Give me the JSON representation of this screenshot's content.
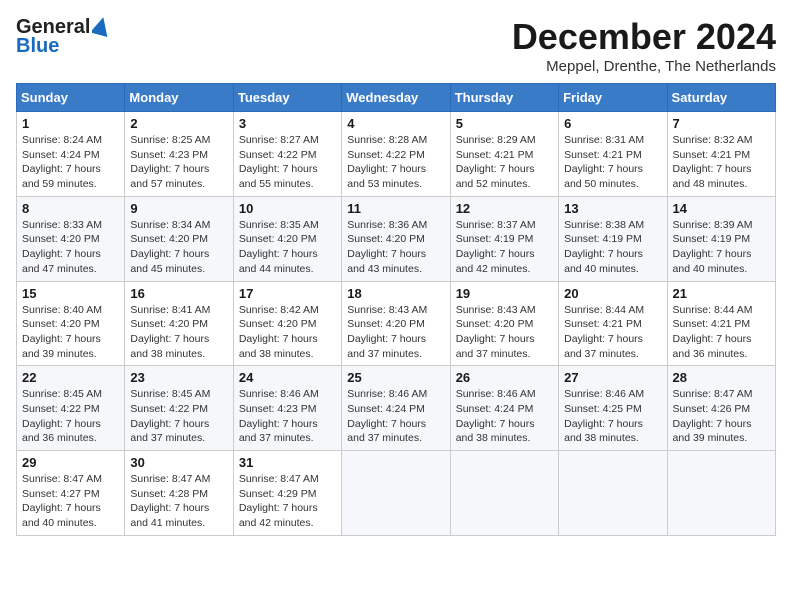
{
  "header": {
    "logo_general": "General",
    "logo_blue": "Blue",
    "month_title": "December 2024",
    "location": "Meppel, Drenthe, The Netherlands"
  },
  "days_of_week": [
    "Sunday",
    "Monday",
    "Tuesday",
    "Wednesday",
    "Thursday",
    "Friday",
    "Saturday"
  ],
  "weeks": [
    [
      {
        "day": "1",
        "sunrise": "Sunrise: 8:24 AM",
        "sunset": "Sunset: 4:24 PM",
        "daylight": "Daylight: 7 hours and 59 minutes."
      },
      {
        "day": "2",
        "sunrise": "Sunrise: 8:25 AM",
        "sunset": "Sunset: 4:23 PM",
        "daylight": "Daylight: 7 hours and 57 minutes."
      },
      {
        "day": "3",
        "sunrise": "Sunrise: 8:27 AM",
        "sunset": "Sunset: 4:22 PM",
        "daylight": "Daylight: 7 hours and 55 minutes."
      },
      {
        "day": "4",
        "sunrise": "Sunrise: 8:28 AM",
        "sunset": "Sunset: 4:22 PM",
        "daylight": "Daylight: 7 hours and 53 minutes."
      },
      {
        "day": "5",
        "sunrise": "Sunrise: 8:29 AM",
        "sunset": "Sunset: 4:21 PM",
        "daylight": "Daylight: 7 hours and 52 minutes."
      },
      {
        "day": "6",
        "sunrise": "Sunrise: 8:31 AM",
        "sunset": "Sunset: 4:21 PM",
        "daylight": "Daylight: 7 hours and 50 minutes."
      },
      {
        "day": "7",
        "sunrise": "Sunrise: 8:32 AM",
        "sunset": "Sunset: 4:21 PM",
        "daylight": "Daylight: 7 hours and 48 minutes."
      }
    ],
    [
      {
        "day": "8",
        "sunrise": "Sunrise: 8:33 AM",
        "sunset": "Sunset: 4:20 PM",
        "daylight": "Daylight: 7 hours and 47 minutes."
      },
      {
        "day": "9",
        "sunrise": "Sunrise: 8:34 AM",
        "sunset": "Sunset: 4:20 PM",
        "daylight": "Daylight: 7 hours and 45 minutes."
      },
      {
        "day": "10",
        "sunrise": "Sunrise: 8:35 AM",
        "sunset": "Sunset: 4:20 PM",
        "daylight": "Daylight: 7 hours and 44 minutes."
      },
      {
        "day": "11",
        "sunrise": "Sunrise: 8:36 AM",
        "sunset": "Sunset: 4:20 PM",
        "daylight": "Daylight: 7 hours and 43 minutes."
      },
      {
        "day": "12",
        "sunrise": "Sunrise: 8:37 AM",
        "sunset": "Sunset: 4:19 PM",
        "daylight": "Daylight: 7 hours and 42 minutes."
      },
      {
        "day": "13",
        "sunrise": "Sunrise: 8:38 AM",
        "sunset": "Sunset: 4:19 PM",
        "daylight": "Daylight: 7 hours and 40 minutes."
      },
      {
        "day": "14",
        "sunrise": "Sunrise: 8:39 AM",
        "sunset": "Sunset: 4:19 PM",
        "daylight": "Daylight: 7 hours and 40 minutes."
      }
    ],
    [
      {
        "day": "15",
        "sunrise": "Sunrise: 8:40 AM",
        "sunset": "Sunset: 4:20 PM",
        "daylight": "Daylight: 7 hours and 39 minutes."
      },
      {
        "day": "16",
        "sunrise": "Sunrise: 8:41 AM",
        "sunset": "Sunset: 4:20 PM",
        "daylight": "Daylight: 7 hours and 38 minutes."
      },
      {
        "day": "17",
        "sunrise": "Sunrise: 8:42 AM",
        "sunset": "Sunset: 4:20 PM",
        "daylight": "Daylight: 7 hours and 38 minutes."
      },
      {
        "day": "18",
        "sunrise": "Sunrise: 8:43 AM",
        "sunset": "Sunset: 4:20 PM",
        "daylight": "Daylight: 7 hours and 37 minutes."
      },
      {
        "day": "19",
        "sunrise": "Sunrise: 8:43 AM",
        "sunset": "Sunset: 4:20 PM",
        "daylight": "Daylight: 7 hours and 37 minutes."
      },
      {
        "day": "20",
        "sunrise": "Sunrise: 8:44 AM",
        "sunset": "Sunset: 4:21 PM",
        "daylight": "Daylight: 7 hours and 37 minutes."
      },
      {
        "day": "21",
        "sunrise": "Sunrise: 8:44 AM",
        "sunset": "Sunset: 4:21 PM",
        "daylight": "Daylight: 7 hours and 36 minutes."
      }
    ],
    [
      {
        "day": "22",
        "sunrise": "Sunrise: 8:45 AM",
        "sunset": "Sunset: 4:22 PM",
        "daylight": "Daylight: 7 hours and 36 minutes."
      },
      {
        "day": "23",
        "sunrise": "Sunrise: 8:45 AM",
        "sunset": "Sunset: 4:22 PM",
        "daylight": "Daylight: 7 hours and 37 minutes."
      },
      {
        "day": "24",
        "sunrise": "Sunrise: 8:46 AM",
        "sunset": "Sunset: 4:23 PM",
        "daylight": "Daylight: 7 hours and 37 minutes."
      },
      {
        "day": "25",
        "sunrise": "Sunrise: 8:46 AM",
        "sunset": "Sunset: 4:24 PM",
        "daylight": "Daylight: 7 hours and 37 minutes."
      },
      {
        "day": "26",
        "sunrise": "Sunrise: 8:46 AM",
        "sunset": "Sunset: 4:24 PM",
        "daylight": "Daylight: 7 hours and 38 minutes."
      },
      {
        "day": "27",
        "sunrise": "Sunrise: 8:46 AM",
        "sunset": "Sunset: 4:25 PM",
        "daylight": "Daylight: 7 hours and 38 minutes."
      },
      {
        "day": "28",
        "sunrise": "Sunrise: 8:47 AM",
        "sunset": "Sunset: 4:26 PM",
        "daylight": "Daylight: 7 hours and 39 minutes."
      }
    ],
    [
      {
        "day": "29",
        "sunrise": "Sunrise: 8:47 AM",
        "sunset": "Sunset: 4:27 PM",
        "daylight": "Daylight: 7 hours and 40 minutes."
      },
      {
        "day": "30",
        "sunrise": "Sunrise: 8:47 AM",
        "sunset": "Sunset: 4:28 PM",
        "daylight": "Daylight: 7 hours and 41 minutes."
      },
      {
        "day": "31",
        "sunrise": "Sunrise: 8:47 AM",
        "sunset": "Sunset: 4:29 PM",
        "daylight": "Daylight: 7 hours and 42 minutes."
      },
      null,
      null,
      null,
      null
    ]
  ]
}
